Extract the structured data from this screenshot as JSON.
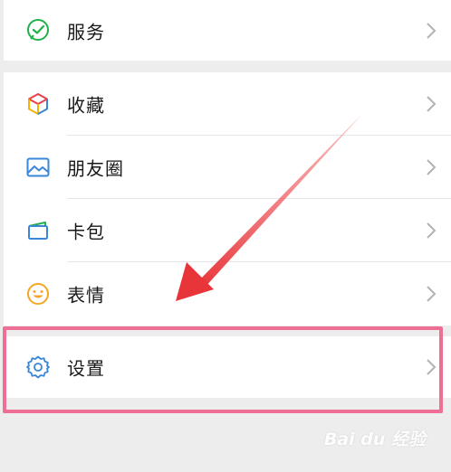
{
  "menu": {
    "services": {
      "label": "服务",
      "icon": "chat-check-icon"
    },
    "favorites": {
      "label": "收藏",
      "icon": "cube-icon"
    },
    "moments": {
      "label": "朋友圈",
      "icon": "image-icon"
    },
    "cards": {
      "label": "卡包",
      "icon": "card-icon"
    },
    "stickers": {
      "label": "表情",
      "icon": "smiley-icon"
    },
    "settings": {
      "label": "设置",
      "icon": "gear-icon"
    }
  },
  "watermark": {
    "text": "Bai du 经验"
  },
  "colors": {
    "highlight": "#ee6f93",
    "arrow": "#e8353a",
    "services_icon": "#22b04a",
    "settings_icon": "#3a86d8"
  }
}
